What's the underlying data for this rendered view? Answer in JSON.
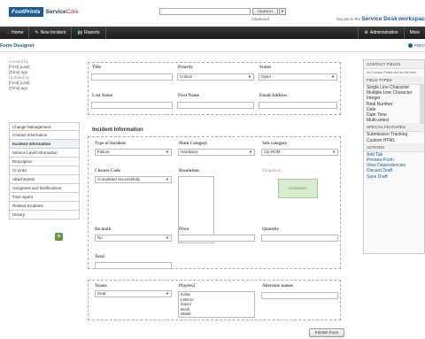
{
  "header": {
    "logo_footprints": "FootPrints",
    "logo_service": "Service",
    "logo_core": "Core",
    "search_button": "SEARCH",
    "search_dropdown": "▼",
    "advanced": "Advanced",
    "you_are_in": "You are in the",
    "workspace": "Service Desk",
    "workspace_suffix": "workspac"
  },
  "nav": {
    "home": "Home",
    "new_incident": "New Incident",
    "reports": "Reports",
    "administration": "Administration",
    "more": "More"
  },
  "form_designer": {
    "title": "Form Designer",
    "preview": "PREV"
  },
  "left_info": {
    "created_by_label": "Created by",
    "created_by_name": "[First] [Last]",
    "created_time": "[Time] ago",
    "updated_by_label": "Updated by",
    "updated_by_name": "[First] [Last]",
    "updated_time": "[Time] ago"
  },
  "left_tabs": [
    "Change Management",
    "Contact Information",
    "Incident Information",
    "Service Level Information",
    "Description",
    "CI Links",
    "Attachments",
    "Assignees and Notifications",
    "Time Spent",
    "Related Incidents",
    "History"
  ],
  "top_fields": {
    "title": "Title",
    "priority": "Priority",
    "priority_value": "Critical",
    "status": "Status",
    "status_value": "Open",
    "last_name": "Last Name",
    "first_name": "First Name",
    "email": "Email Address"
  },
  "incident": {
    "section_title": "Incident Information",
    "type_label": "Type of Incident",
    "type_value": "Failure",
    "main_cat_label": "Main Category",
    "main_cat_value": "Hardware",
    "sub_cat_label": "Sub-category",
    "sub_cat_value": "CD-ROM",
    "closure_label": "Closure Code",
    "closure_value": "Completed Successfully",
    "resolution_label": "Resolution",
    "dropdown_label": "Dropdown",
    "dropdown_box": "Dropdown",
    "math_label": "Do math",
    "math_value": "No",
    "price_label": "Price",
    "quantity_label": "Quantity",
    "total_label": "Total",
    "teams_label": "Teams",
    "teams_value": "Heat",
    "players_label": "Players2",
    "players": [
      "Kobe",
      "LeBron",
      "Gasol",
      "Bosh",
      "Wade"
    ],
    "alternate_label": "Alternate names"
  },
  "publish": "Publish Form",
  "right_panel": {
    "contact_fields": "CONTACT FIELDS",
    "contact_note": "All Contact Fields are on the form",
    "field_types": "FIELD TYPES",
    "types": [
      "Single Line Character",
      "Multiple Line Character",
      "Integer",
      "Real Number",
      "Date",
      "Date Time",
      "Multi-select"
    ],
    "special_features": "SPECIAL FEATURES",
    "specials": [
      "Submission Tracking",
      "Custom HTML"
    ],
    "actions": "ACTIONS",
    "action_links": [
      "Add Tab",
      "Preview Form",
      "View Dependencies",
      "Discard Draft",
      "Save Draft"
    ]
  }
}
